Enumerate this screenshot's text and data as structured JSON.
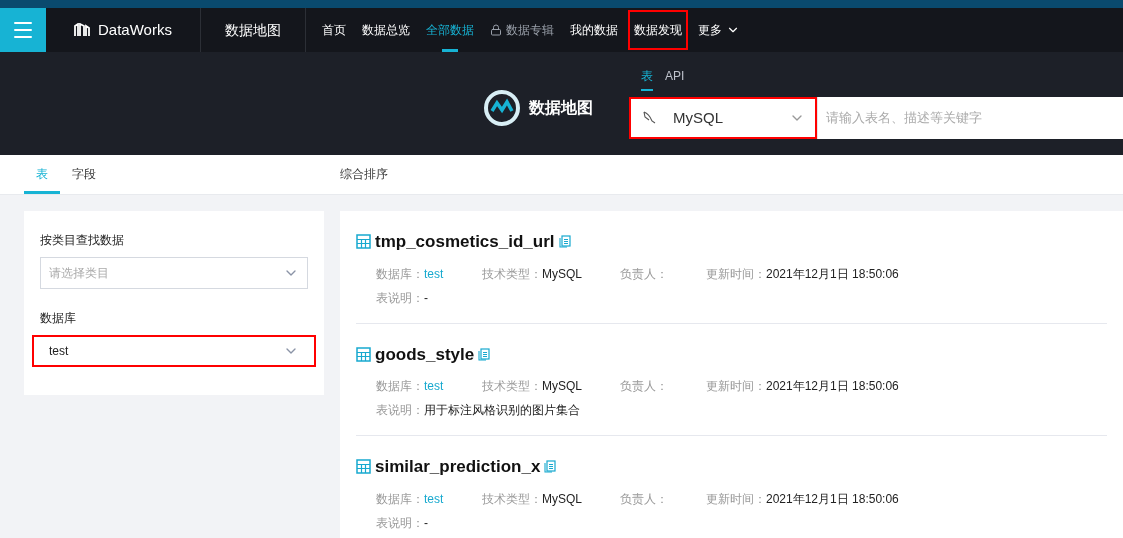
{
  "nav": {
    "brand": "DataWorks",
    "module": "数据地图",
    "items": [
      {
        "label": "首页",
        "selected": false,
        "locked": false,
        "highlighted": false,
        "dropdown": false
      },
      {
        "label": "数据总览",
        "selected": false,
        "locked": false,
        "highlighted": false,
        "dropdown": false
      },
      {
        "label": "全部数据",
        "selected": true,
        "locked": false,
        "highlighted": false,
        "dropdown": false
      },
      {
        "label": "数据专辑",
        "selected": false,
        "locked": true,
        "highlighted": false,
        "dropdown": false
      },
      {
        "label": "我的数据",
        "selected": false,
        "locked": false,
        "highlighted": false,
        "dropdown": false
      },
      {
        "label": "数据发现",
        "selected": false,
        "locked": false,
        "highlighted": true,
        "dropdown": false
      },
      {
        "label": "更多",
        "selected": false,
        "locked": false,
        "highlighted": false,
        "dropdown": true
      }
    ]
  },
  "banner": {
    "title": "数据地图",
    "tabs": [
      {
        "label": "表",
        "selected": true
      },
      {
        "label": "API",
        "selected": false
      }
    ],
    "source_select": {
      "value": "MySQL",
      "highlighted": true
    },
    "search": {
      "placeholder": "请输入表名、描述等关键字"
    }
  },
  "result_tabs": [
    {
      "label": "表",
      "selected": true
    },
    {
      "label": "字段",
      "selected": false
    }
  ],
  "sort_label": "综合排序",
  "filters": {
    "category": {
      "label": "按类目查找数据",
      "placeholder": "请选择类目"
    },
    "database": {
      "label": "数据库",
      "value": "test",
      "highlighted": true
    }
  },
  "results": [
    {
      "name": "tmp_cosmetics_id_url",
      "db_label": "数据库：",
      "db": "test",
      "type_label": "技术类型：",
      "type": "MySQL",
      "owner_label": "负责人：",
      "time_label": "更新时间：",
      "time": "2021年12月1日 18:50:06",
      "desc_label": "表说明：",
      "desc": "-"
    },
    {
      "name": "goods_style",
      "db_label": "数据库：",
      "db": "test",
      "type_label": "技术类型：",
      "type": "MySQL",
      "owner_label": "负责人：",
      "time_label": "更新时间：",
      "time": "2021年12月1日 18:50:06",
      "desc_label": "表说明：",
      "desc": "用于标注风格识别的图片集合"
    },
    {
      "name": "similar_prediction_x",
      "db_label": "数据库：",
      "db": "test",
      "type_label": "技术类型：",
      "type": "MySQL",
      "owner_label": "负责人：",
      "time_label": "更新时间：",
      "time": "2021年12月1日 18:50:06",
      "desc_label": "表说明：",
      "desc": "-"
    }
  ]
}
